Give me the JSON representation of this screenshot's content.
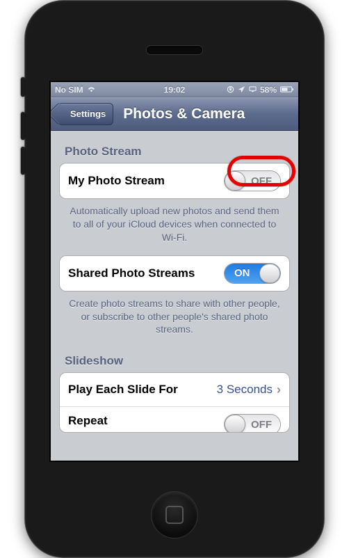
{
  "statusbar": {
    "carrier": "No SIM",
    "time": "19:02",
    "battery_pct": "58%"
  },
  "navbar": {
    "back_label": "Settings",
    "title": "Photos & Camera"
  },
  "section_photo_stream": {
    "header": "Photo Stream",
    "my_photo_stream": {
      "label": "My Photo Stream",
      "state_text": "OFF",
      "on": false
    },
    "my_photo_stream_footer": "Automatically upload new photos and send them to all of your iCloud devices when connected to Wi-Fi.",
    "shared_streams": {
      "label": "Shared Photo Streams",
      "state_text": "ON",
      "on": true
    },
    "shared_streams_footer": "Create photo streams to share with other people, or subscribe to other people's shared photo streams."
  },
  "section_slideshow": {
    "header": "Slideshow",
    "play_each_slide": {
      "label": "Play Each Slide For",
      "value": "3 Seconds"
    },
    "repeat": {
      "label": "Repeat",
      "state_text": "OFF",
      "on": false
    }
  }
}
